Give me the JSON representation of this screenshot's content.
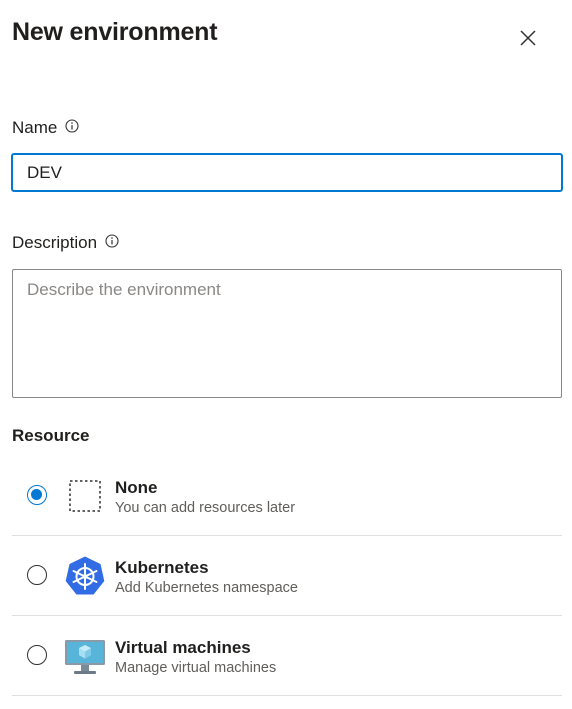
{
  "dialog": {
    "title": "New environment"
  },
  "name_field": {
    "label": "Name",
    "value": "DEV"
  },
  "description_field": {
    "label": "Description",
    "placeholder": "Describe the environment",
    "value": ""
  },
  "resource": {
    "label": "Resource",
    "selected": "None",
    "options": [
      {
        "title": "None",
        "subtitle": "You can add resources later",
        "icon": "dashed-square-icon"
      },
      {
        "title": "Kubernetes",
        "subtitle": "Add Kubernetes namespace",
        "icon": "kubernetes-icon"
      },
      {
        "title": "Virtual machines",
        "subtitle": "Manage virtual machines",
        "icon": "virtual-machine-icon"
      }
    ]
  },
  "colors": {
    "accent": "#0078d4",
    "kubernetes": "#326ce5",
    "text": "#201f1e",
    "secondary_text": "#605e5c"
  }
}
